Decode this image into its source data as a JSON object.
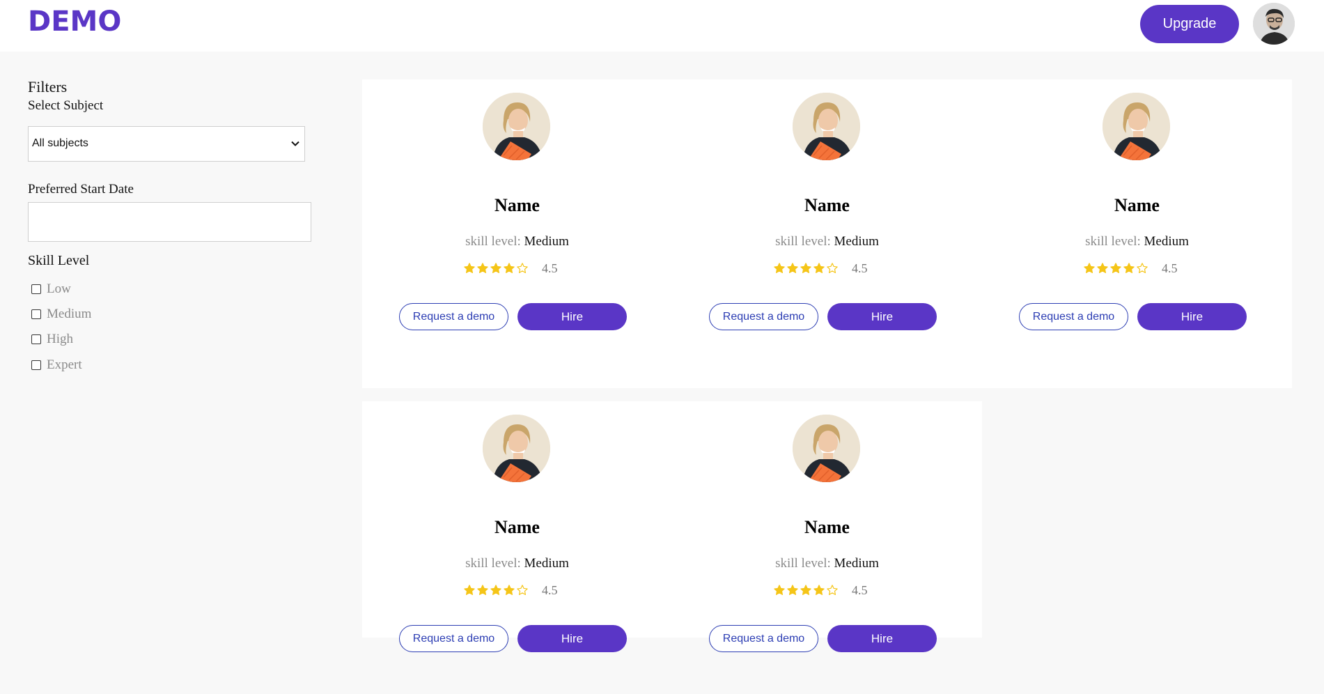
{
  "header": {
    "logo": "DEMO",
    "upgrade_label": "Upgrade"
  },
  "filters": {
    "title": "Filters",
    "subject_label": "Select Subject",
    "subject_value": "All subjects",
    "start_date_label": "Preferred Start Date",
    "start_date_value": "",
    "skill_label": "Skill Level",
    "skill_options": [
      {
        "label": "Low",
        "checked": false
      },
      {
        "label": "Medium",
        "checked": false
      },
      {
        "label": "High",
        "checked": false
      },
      {
        "label": "Expert",
        "checked": false
      }
    ]
  },
  "tutors": [
    {
      "name": "Name",
      "skill_label": "skill level:",
      "skill_value": "Medium",
      "rating": "4.5",
      "stars_filled": 4,
      "stars_total": 5,
      "demo_label": "Request a demo",
      "hire_label": "Hire"
    },
    {
      "name": "Name",
      "skill_label": "skill level:",
      "skill_value": "Medium",
      "rating": "4.5",
      "stars_filled": 4,
      "stars_total": 5,
      "demo_label": "Request a demo",
      "hire_label": "Hire"
    },
    {
      "name": "Name",
      "skill_label": "skill level:",
      "skill_value": "Medium",
      "rating": "4.5",
      "stars_filled": 4,
      "stars_total": 5,
      "demo_label": "Request a demo",
      "hire_label": "Hire"
    },
    {
      "name": "Name",
      "skill_label": "skill level:",
      "skill_value": "Medium",
      "rating": "4.5",
      "stars_filled": 4,
      "stars_total": 5,
      "demo_label": "Request a demo",
      "hire_label": "Hire"
    },
    {
      "name": "Name",
      "skill_label": "skill level:",
      "skill_value": "Medium",
      "rating": "4.5",
      "stars_filled": 4,
      "stars_total": 5,
      "demo_label": "Request a demo",
      "hire_label": "Hire"
    }
  ],
  "colors": {
    "brand": "#5a36c6",
    "link": "#2c3db3",
    "star": "#f5c518"
  },
  "icons": {
    "select_chevron": "chevron-down-icon",
    "star_filled": "star-filled-icon",
    "star_empty": "star-outline-icon"
  }
}
